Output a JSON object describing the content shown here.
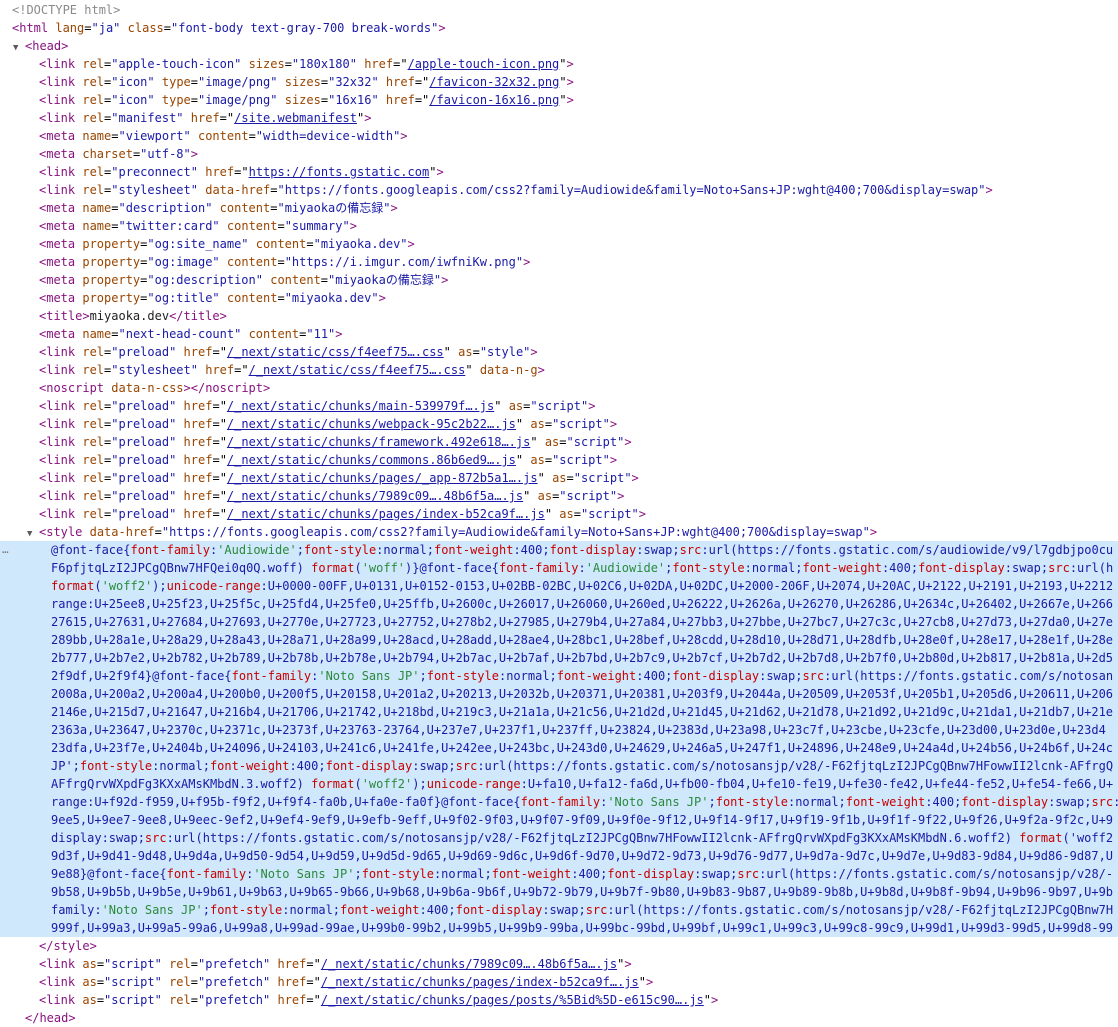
{
  "colors": {
    "tag": "#881280",
    "attribute": "#994500",
    "value": "#1a1aa6",
    "selection": "#cfe8fc",
    "css_property": "#c80000",
    "css_string": "#2a8a3a"
  },
  "doctype": "<!DOCTYPE html>",
  "html_open": {
    "tag": "html",
    "attrs": [
      [
        "lang",
        "\"ja\""
      ],
      [
        "class",
        "\"font-body text-gray-700 break-words\""
      ]
    ]
  },
  "head_open": "head",
  "head_children": [
    {
      "kind": "tag",
      "tag": "link",
      "attrs": [
        [
          "rel",
          "\"apple-touch-icon\""
        ],
        [
          "sizes",
          "\"180x180\""
        ],
        [
          "href",
          "/apple-touch-icon.png",
          "link"
        ]
      ]
    },
    {
      "kind": "tag",
      "tag": "link",
      "attrs": [
        [
          "rel",
          "\"icon\""
        ],
        [
          "type",
          "\"image/png\""
        ],
        [
          "sizes",
          "\"32x32\""
        ],
        [
          "href",
          "/favicon-32x32.png",
          "link"
        ]
      ]
    },
    {
      "kind": "tag",
      "tag": "link",
      "attrs": [
        [
          "rel",
          "\"icon\""
        ],
        [
          "type",
          "\"image/png\""
        ],
        [
          "sizes",
          "\"16x16\""
        ],
        [
          "href",
          "/favicon-16x16.png",
          "link"
        ]
      ]
    },
    {
      "kind": "tag",
      "tag": "link",
      "attrs": [
        [
          "rel",
          "\"manifest\""
        ],
        [
          "href",
          "/site.webmanifest",
          "link"
        ]
      ]
    },
    {
      "kind": "tag",
      "tag": "meta",
      "attrs": [
        [
          "name",
          "\"viewport\""
        ],
        [
          "content",
          "\"width=device-width\""
        ]
      ]
    },
    {
      "kind": "tag",
      "tag": "meta",
      "attrs": [
        [
          "charset",
          "\"utf-8\""
        ]
      ]
    },
    {
      "kind": "tag",
      "tag": "link",
      "attrs": [
        [
          "rel",
          "\"preconnect\""
        ],
        [
          "href",
          "https://fonts.gstatic.com",
          "link"
        ]
      ]
    },
    {
      "kind": "tag",
      "tag": "link",
      "attrs": [
        [
          "rel",
          "\"stylesheet\""
        ],
        [
          "data-href",
          "\"https://fonts.googleapis.com/css2?family=Audiowide&family=Noto+Sans+JP:wght@400;700&display=swap\""
        ]
      ]
    },
    {
      "kind": "tag",
      "tag": "meta",
      "attrs": [
        [
          "name",
          "\"description\""
        ],
        [
          "content",
          "\"miyaokaの備忘録\""
        ]
      ]
    },
    {
      "kind": "tag",
      "tag": "meta",
      "attrs": [
        [
          "name",
          "\"twitter:card\""
        ],
        [
          "content",
          "\"summary\""
        ]
      ]
    },
    {
      "kind": "tag",
      "tag": "meta",
      "attrs": [
        [
          "property",
          "\"og:site_name\""
        ],
        [
          "content",
          "\"miyaoka.dev\""
        ]
      ]
    },
    {
      "kind": "tag",
      "tag": "meta",
      "attrs": [
        [
          "property",
          "\"og:image\""
        ],
        [
          "content",
          "\"https://i.imgur.com/iwfniKw.png\""
        ]
      ]
    },
    {
      "kind": "tag",
      "tag": "meta",
      "attrs": [
        [
          "property",
          "\"og:description\""
        ],
        [
          "content",
          "\"miyaokaの備忘録\""
        ]
      ]
    },
    {
      "kind": "tag",
      "tag": "meta",
      "attrs": [
        [
          "property",
          "\"og:title\""
        ],
        [
          "content",
          "\"miyaoka.dev\""
        ]
      ]
    },
    {
      "kind": "text",
      "tag": "title",
      "text": "miyaoka.dev"
    },
    {
      "kind": "tag",
      "tag": "meta",
      "attrs": [
        [
          "name",
          "\"next-head-count\""
        ],
        [
          "content",
          "\"11\""
        ]
      ]
    },
    {
      "kind": "tag",
      "tag": "link",
      "attrs": [
        [
          "rel",
          "\"preload\""
        ],
        [
          "href",
          "/_next/static/css/f4eef75….css",
          "link"
        ],
        [
          "as",
          "\"style\""
        ]
      ]
    },
    {
      "kind": "tag",
      "tag": "link",
      "attrs": [
        [
          "rel",
          "\"stylesheet\""
        ],
        [
          "href",
          "/_next/static/css/f4eef75….css",
          "link"
        ],
        [
          "data-n-g",
          ""
        ]
      ]
    },
    {
      "kind": "empty",
      "tag": "noscript",
      "attrs": [
        [
          "data-n-css",
          ""
        ]
      ]
    },
    {
      "kind": "tag",
      "tag": "link",
      "attrs": [
        [
          "rel",
          "\"preload\""
        ],
        [
          "href",
          "/_next/static/chunks/main-539979f….js",
          "link"
        ],
        [
          "as",
          "\"script\""
        ]
      ]
    },
    {
      "kind": "tag",
      "tag": "link",
      "attrs": [
        [
          "rel",
          "\"preload\""
        ],
        [
          "href",
          "/_next/static/chunks/webpack-95c2b22….js",
          "link"
        ],
        [
          "as",
          "\"script\""
        ]
      ]
    },
    {
      "kind": "tag",
      "tag": "link",
      "attrs": [
        [
          "rel",
          "\"preload\""
        ],
        [
          "href",
          "/_next/static/chunks/framework.492e618….js",
          "link"
        ],
        [
          "as",
          "\"script\""
        ]
      ]
    },
    {
      "kind": "tag",
      "tag": "link",
      "attrs": [
        [
          "rel",
          "\"preload\""
        ],
        [
          "href",
          "/_next/static/chunks/commons.86b6ed9….js",
          "link"
        ],
        [
          "as",
          "\"script\""
        ]
      ]
    },
    {
      "kind": "tag",
      "tag": "link",
      "attrs": [
        [
          "rel",
          "\"preload\""
        ],
        [
          "href",
          "/_next/static/chunks/pages/_app-872b5a1….js",
          "link"
        ],
        [
          "as",
          "\"script\""
        ]
      ]
    },
    {
      "kind": "tag",
      "tag": "link",
      "attrs": [
        [
          "rel",
          "\"preload\""
        ],
        [
          "href",
          "/_next/static/chunks/7989c09….48b6f5a….js",
          "link"
        ],
        [
          "as",
          "\"script\""
        ]
      ]
    },
    {
      "kind": "tag",
      "tag": "link",
      "attrs": [
        [
          "rel",
          "\"preload\""
        ],
        [
          "href",
          "/_next/static/chunks/pages/index-b52ca9f….js",
          "link"
        ],
        [
          "as",
          "\"script\""
        ]
      ]
    }
  ],
  "style_open": {
    "tag": "style",
    "attrs": [
      [
        "data-href",
        "\"https://fonts.googleapis.com/css2?family=Audiowide&family=Noto+Sans+JP:wght@400;700&display=swap\""
      ]
    ]
  },
  "style_text_lines": [
    "@font-face{font-family:'Audiowide';font-style:normal;font-weight:400;font-display:swap;src:url(https://fonts.gstatic.com/s/audiowide/v9/l7gdbjpo0cu",
    "F6pfjtqLzI2JPCgQBnw7HFQei0q0Q.woff) format('woff')}@font-face{font-family:'Audiowide';font-style:normal;font-weight:400;font-display:swap;src:url(h",
    "format('woff2');unicode-range:U+0000-00FF,U+0131,U+0152-0153,U+02BB-02BC,U+02C6,U+02DA,U+02DC,U+2000-206F,U+2074,U+20AC,U+2122,U+2191,U+2193,U+2212",
    "range:U+25ee8,U+25f23,U+25f5c,U+25fd4,U+25fe0,U+25ffb,U+2600c,U+26017,U+26060,U+260ed,U+26222,U+2626a,U+26270,U+26286,U+2634c,U+26402,U+2667e,U+266",
    "27615,U+27631,U+27684,U+27693,U+2770e,U+27723,U+27752,U+278b2,U+27985,U+279b4,U+27a84,U+27bb3,U+27bbe,U+27bc7,U+27c3c,U+27cb8,U+27d73,U+27da0,U+27e",
    "289bb,U+28a1e,U+28a29,U+28a43,U+28a71,U+28a99,U+28acd,U+28add,U+28ae4,U+28bc1,U+28bef,U+28cdd,U+28d10,U+28d71,U+28dfb,U+28e0f,U+28e17,U+28e1f,U+28e",
    "2b777,U+2b7e2,U+2b782,U+2b789,U+2b78b,U+2b78e,U+2b794,U+2b7ac,U+2b7af,U+2b7bd,U+2b7c9,U+2b7cf,U+2b7d2,U+2b7d8,U+2b7f0,U+2b80d,U+2b817,U+2b81a,U+2d5",
    "2f9df,U+2f9f4}@font-face{font-family:'Noto Sans JP';font-style:normal;font-weight:400;font-display:swap;src:url(https://fonts.gstatic.com/s/notosan",
    "2008a,U+200a2,U+200a4,U+200b0,U+200f5,U+20158,U+201a2,U+20213,U+2032b,U+20371,U+20381,U+203f9,U+2044a,U+20509,U+2053f,U+205b1,U+205d6,U+20611,U+206",
    "2146e,U+215d7,U+21647,U+216b4,U+21706,U+21742,U+218bd,U+219c3,U+21a1a,U+21c56,U+21d2d,U+21d45,U+21d62,U+21d78,U+21d92,U+21d9c,U+21da1,U+21db7,U+21e",
    "2363a,U+23647,U+2370c,U+2371c,U+2373f,U+23763-23764,U+237e7,U+237f1,U+237ff,U+23824,U+2383d,U+23a98,U+23c7f,U+23cbe,U+23cfe,U+23d00,U+23d0e,U+23d4",
    "23dfa,U+23f7e,U+2404b,U+24096,U+24103,U+241c6,U+241fe,U+242ee,U+243bc,U+243d0,U+24629,U+246a5,U+247f1,U+24896,U+248e9,U+24a4d,U+24b56,U+24b6f,U+24c",
    "JP';font-style:normal;font-weight:400;font-display:swap;src:url(https://fonts.gstatic.com/s/notosansjp/v28/-F62fjtqLzI2JPCgQBnw7HFowwII2lcnk-AFfrgQ",
    "AFfrgQrvWXpdFg3KXxAMsKMbdN.3.woff2) format('woff2');unicode-range:U+fa10,U+fa12-fa6d,U+fb00-fb04,U+fe10-fe19,U+fe30-fe42,U+fe44-fe52,U+fe54-fe66,U+",
    "range:U+f92d-f959,U+f95b-f9f2,U+f9f4-fa0b,U+fa0e-fa0f}@font-face{font-family:'Noto Sans JP';font-style:normal;font-weight:400;font-display:swap;src:",
    "9ee5,U+9ee7-9ee8,U+9eec-9ef2,U+9ef4-9ef9,U+9efb-9eff,U+9f02-9f03,U+9f07-9f09,U+9f0e-9f12,U+9f14-9f17,U+9f19-9f1b,U+9f1f-9f22,U+9f26,U+9f2a-9f2c,U+9",
    "display:swap;src:url(https://fonts.gstatic.com/s/notosansjp/v28/-F62fjtqLzI2JPCgQBnw7HFowwII2lcnk-AFfrgQrvWXpdFg3KXxAMsKMbdN.6.woff2) format('woff2",
    "9d3f,U+9d41-9d48,U+9d4a,U+9d50-9d54,U+9d59,U+9d5d-9d65,U+9d69-9d6c,U+9d6f-9d70,U+9d72-9d73,U+9d76-9d77,U+9d7a-9d7c,U+9d7e,U+9d83-9d84,U+9d86-9d87,U",
    "9e88}@font-face{font-family:'Noto Sans JP';font-style:normal;font-weight:400;font-display:swap;src:url(https://fonts.gstatic.com/s/notosansjp/v28/-",
    "9b58,U+9b5b,U+9b5e,U+9b61,U+9b63,U+9b65-9b66,U+9b68,U+9b6a-9b6f,U+9b72-9b79,U+9b7f-9b80,U+9b83-9b87,U+9b89-9b8b,U+9b8d,U+9b8f-9b94,U+9b96-9b97,U+9b",
    "family:'Noto Sans JP';font-style:normal;font-weight:400;font-display:swap;src:url(https://fonts.gstatic.com/s/notosansjp/v28/-F62fjtqLzI2JPCgQBnw7H",
    "999f,U+99a3,U+99a5-99a6,U+99a8,U+99ad-99ae,U+99b0-99b2,U+99b5,U+99b9-99ba,U+99bc-99bd,U+99bf,U+99c1,U+99c3,U+99c8-99c9,U+99d1,U+99d3-99d5,U+99d8-99"
  ],
  "style_close": "style",
  "after_style": [
    {
      "kind": "tag",
      "tag": "link",
      "attrs": [
        [
          "as",
          "\"script\""
        ],
        [
          "rel",
          "\"prefetch\""
        ],
        [
          "href",
          "/_next/static/chunks/7989c09….48b6f5a….js",
          "link"
        ]
      ]
    },
    {
      "kind": "tag",
      "tag": "link",
      "attrs": [
        [
          "as",
          "\"script\""
        ],
        [
          "rel",
          "\"prefetch\""
        ],
        [
          "href",
          "/_next/static/chunks/pages/index-b52ca9f….js",
          "link"
        ]
      ]
    },
    {
      "kind": "tag",
      "tag": "link",
      "attrs": [
        [
          "as",
          "\"script\""
        ],
        [
          "rel",
          "\"prefetch\""
        ],
        [
          "href",
          "/_next/static/chunks/pages/posts/%5Bid%5D-e615c90….js",
          "link"
        ]
      ]
    }
  ],
  "head_close": "head",
  "gutter_marker": "…"
}
